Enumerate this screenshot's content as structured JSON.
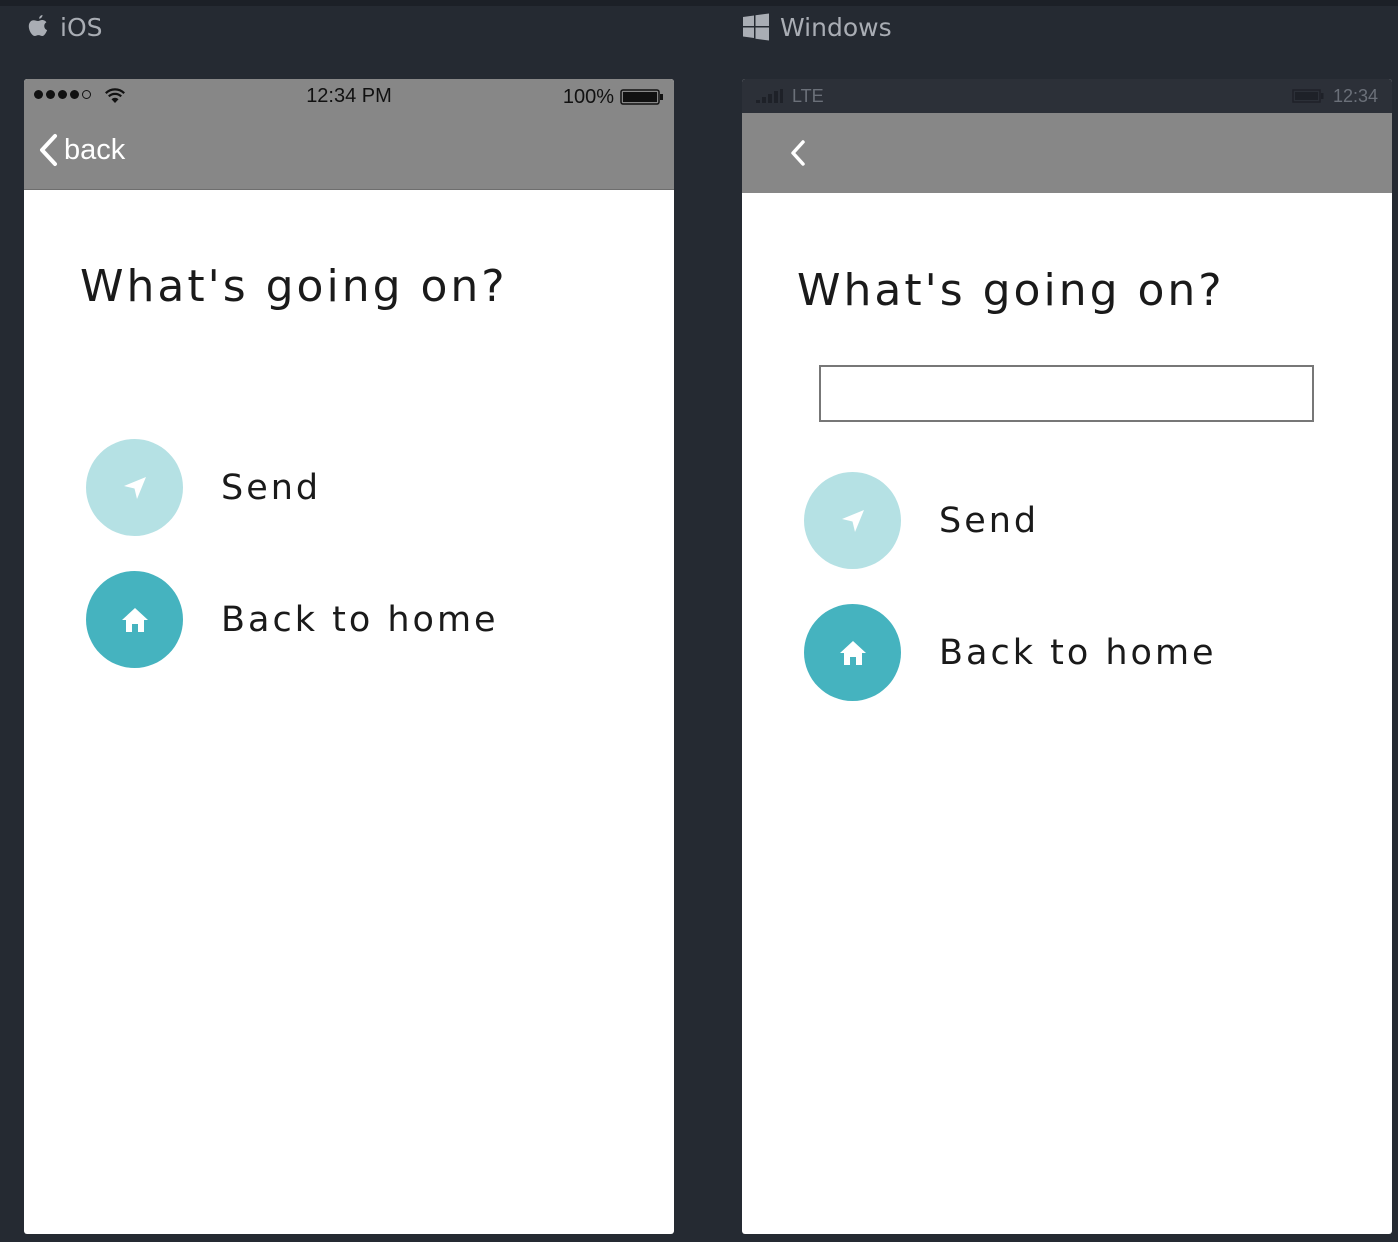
{
  "platforms": {
    "ios": {
      "label": "iOS",
      "status": {
        "time": "12:34 PM",
        "battery": "100%"
      },
      "nav": {
        "back_label": "back"
      },
      "heading": "What's going on?",
      "actions": [
        {
          "label": "Send",
          "icon": "send-icon",
          "style": "light"
        },
        {
          "label": "Back to home",
          "icon": "home-icon",
          "style": "dark"
        }
      ]
    },
    "windows": {
      "label": "Windows",
      "status": {
        "network": "LTE",
        "time": "12:34"
      },
      "heading": "What's going on?",
      "input": {
        "value": "",
        "placeholder": ""
      },
      "actions": [
        {
          "label": "Send",
          "icon": "send-icon",
          "style": "light"
        },
        {
          "label": "Back to home",
          "icon": "home-icon",
          "style": "dark"
        }
      ]
    }
  },
  "colors": {
    "background": "#252a32",
    "nav_bar": "#878787",
    "accent_light": "#b5e1e4",
    "accent_dark": "#45b3bf",
    "label_text": "#a9adb4"
  }
}
